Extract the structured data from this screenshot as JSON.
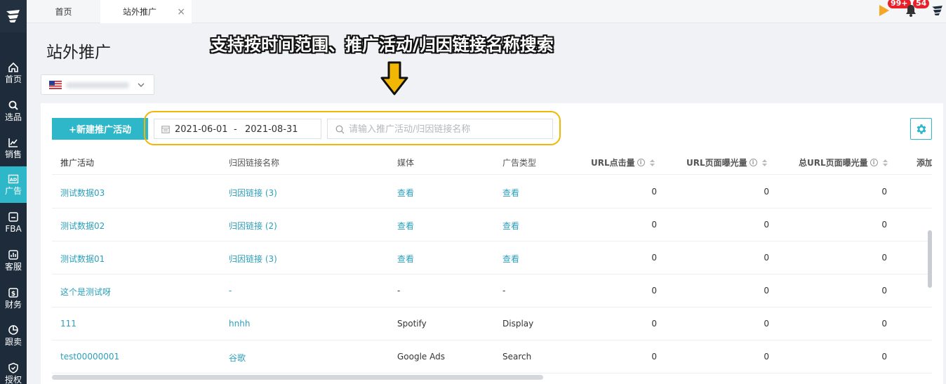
{
  "tabs": {
    "home": "首页",
    "active": "站外推广",
    "close": "×"
  },
  "badges": {
    "notifications_a": "99+",
    "notifications_b": "54"
  },
  "sidebar": {
    "items": [
      {
        "label": "首页",
        "icon": "home-icon"
      },
      {
        "label": "选品",
        "icon": "search-icon"
      },
      {
        "label": "销售",
        "icon": "chart-line-icon"
      },
      {
        "label": "广告",
        "icon": "ad-icon"
      },
      {
        "label": "FBA",
        "icon": "box-icon"
      },
      {
        "label": "客服",
        "icon": "service-icon"
      },
      {
        "label": "财务",
        "icon": "finance-icon"
      },
      {
        "label": "跟卖",
        "icon": "pie-icon"
      },
      {
        "label": "授权",
        "icon": "shield-icon"
      }
    ]
  },
  "page": {
    "title": "站外推广"
  },
  "annotation": "支持按时间范围、推广活动/归因链接名称搜索",
  "toolbar": {
    "new_button": "+新建推广活动",
    "date_start": "2021-06-01",
    "date_sep": "-",
    "date_end": "2021-08-31",
    "search_placeholder": "请输入推广活动/归因链接名称"
  },
  "table": {
    "headers": [
      "推广活动",
      "归因链接名称",
      "媒体",
      "广告类型",
      "URL点击量",
      "URL页面曝光量",
      "总URL页面曝光量",
      "添加"
    ],
    "rows": [
      [
        "测试数据03",
        "归因链接 (3)",
        "查看",
        "查看",
        "0",
        "0",
        "0"
      ],
      [
        "测试数据02",
        "归因链接 (2)",
        "查看",
        "查看",
        "0",
        "0",
        "0"
      ],
      [
        "测试数据01",
        "归因链接 (3)",
        "查看",
        "查看",
        "0",
        "0",
        "0"
      ],
      [
        "这个是测试呀",
        "-",
        "-",
        "-",
        "0",
        "0",
        "0"
      ],
      [
        "111",
        "hnhh",
        "Spotify",
        "Display",
        "0",
        "0",
        "0"
      ],
      [
        "test00000001",
        "谷歌",
        "Google Ads",
        "Search",
        "0",
        "0",
        "0"
      ]
    ]
  },
  "colors": {
    "accent": "#2db7c8",
    "link": "#2b9fba",
    "sidebar": "#1d2b3a",
    "highlight": "#f2b705"
  }
}
